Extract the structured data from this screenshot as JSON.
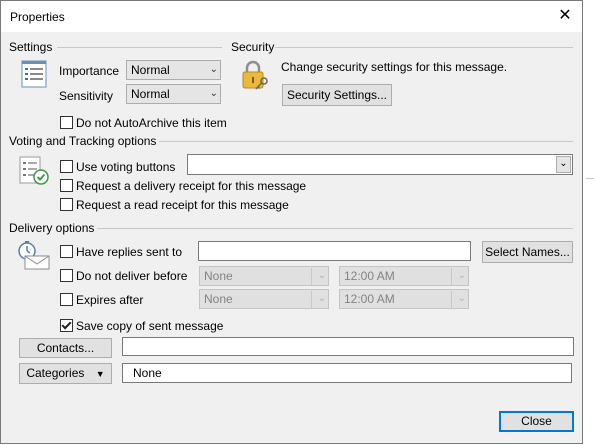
{
  "window": {
    "title": "Properties",
    "close_glyph": "✕"
  },
  "settings": {
    "section_label": "Settings",
    "importance_label": "Importance",
    "importance_value": "Normal",
    "sensitivity_label": "Sensitivity",
    "sensitivity_value": "Normal",
    "autoarchive_label": "Do not AutoArchive this item",
    "autoarchive_checked": false
  },
  "security": {
    "section_label": "Security",
    "description": "Change security settings for this message.",
    "button_label": "Security Settings..."
  },
  "voting": {
    "section_label": "Voting and Tracking options",
    "use_voting_label": "Use voting buttons",
    "voting_value": "",
    "delivery_receipt_label": "Request a delivery receipt for this message",
    "read_receipt_label": "Request a read receipt for this message"
  },
  "delivery": {
    "section_label": "Delivery options",
    "replies_label": "Have replies sent to",
    "replies_value": "",
    "select_names_label": "Select Names...",
    "do_not_deliver_label": "Do not deliver before",
    "do_not_deliver_date": "None",
    "do_not_deliver_time": "12:00 AM",
    "expires_label": "Expires after",
    "expires_date": "None",
    "expires_time": "12:00 AM",
    "save_copy_label": "Save copy of sent message",
    "save_copy_checked": true
  },
  "contacts": {
    "button_label": "Contacts...",
    "value": ""
  },
  "categories": {
    "button_label": "Categories",
    "value": "None"
  },
  "footer": {
    "close_label": "Close"
  },
  "icons": {
    "settings": "settings-list-icon",
    "security": "padlock-key-icon",
    "voting": "voting-checklist-icon",
    "delivery": "delivery-timer-icon",
    "dropdown": "chevron-down-icon"
  }
}
